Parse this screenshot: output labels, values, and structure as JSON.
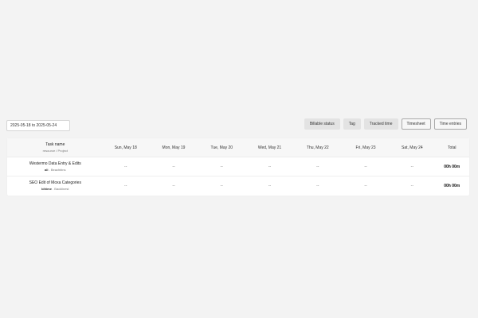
{
  "toolbar": {
    "date_range": "2025-05-18 to 2025-05-24",
    "filters": [
      "Billable status",
      "Tag",
      "Tracked time"
    ],
    "views": [
      "Timesheet",
      "Time entries"
    ]
  },
  "table": {
    "header": {
      "task": "Task name",
      "task_sub": "resource / Project",
      "days": [
        "Sun, May 18",
        "Mon, May 19",
        "Tue, May 20",
        "Wed, May 21",
        "Thu, May 22",
        "Fri, May 23",
        "Sat, May 24"
      ],
      "total": "Total"
    },
    "rows": [
      {
        "title": "Westermo Data Entry & Edits",
        "user": "ali",
        "project": "Beachbins",
        "days": [
          "--",
          "--",
          "--",
          "--",
          "--",
          "--",
          "--"
        ],
        "total": "00h 00m"
      },
      {
        "title": "SEO Edit of Moxa Categories",
        "user": "bihime",
        "project": "Backlinest",
        "days": [
          "--",
          "--",
          "--",
          "--",
          "--",
          "--",
          "--"
        ],
        "total": "00h 00m"
      }
    ]
  }
}
